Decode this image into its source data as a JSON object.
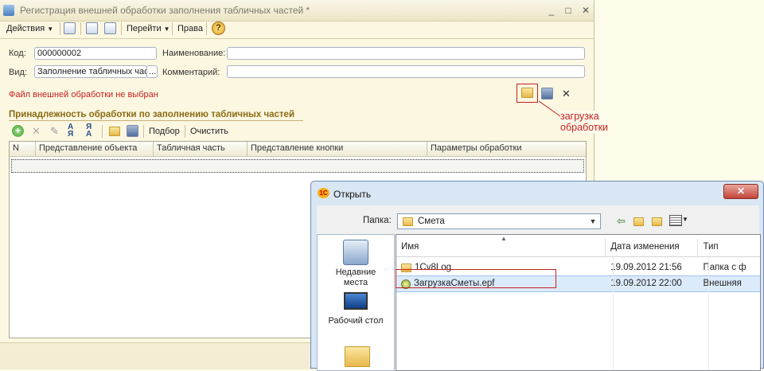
{
  "main_window": {
    "title": "Регистрация внешней обработки заполнения табличных частей *",
    "window_controls": {
      "minimize": "_",
      "maximize": "□",
      "close": "✕"
    },
    "toolbar": {
      "actions_label": "Действия",
      "goto_label": "Перейти",
      "rights_label": "Права",
      "help_label": "?"
    },
    "form": {
      "code_label": "Код:",
      "code_value": "000000002",
      "name_label": "Наименование:",
      "name_value": "",
      "kind_label": "Вид:",
      "kind_value": "Заполнение табличных час",
      "kind_ellipsis": "...",
      "comment_label": "Комментарий:",
      "comment_value": "",
      "file_status": "Файл внешней обработки не выбран",
      "close_file_label": "✕"
    },
    "annotation": "загрузка обработки",
    "section_title": "Принадлежность обработки по заполнению табличных частей",
    "grid_toolbar": {
      "selection_label": "Подбор",
      "clear_label": "Очистить"
    },
    "grid_columns": [
      "N",
      "Представление объекта",
      "Табличная часть",
      "Представление кнопки",
      "Параметры обработки"
    ]
  },
  "open_dialog": {
    "title": "Открыть",
    "folder_label": "Папка:",
    "folder_value": "Смета",
    "places": [
      {
        "label": "Недавние места",
        "icon": "recent-places-icon"
      },
      {
        "label": "Рабочий стол",
        "icon": "desktop-icon"
      }
    ],
    "columns": [
      "Имя",
      "Дата изменения",
      "Тип"
    ],
    "files": [
      {
        "name": "1Cv8Log",
        "date": "19.09.2012 21:56",
        "type": "Папка с ф",
        "icon": "folder-icon"
      },
      {
        "name": "ЗагрузкаСметы.epf",
        "date": "19.09.2012 22:00",
        "type": "Внешняя",
        "icon": "epf-file-icon"
      }
    ]
  },
  "colors": {
    "highlight_red": "#c62020",
    "section_title": "#8a6b12",
    "dialog_frame": "#d9e6f4"
  }
}
